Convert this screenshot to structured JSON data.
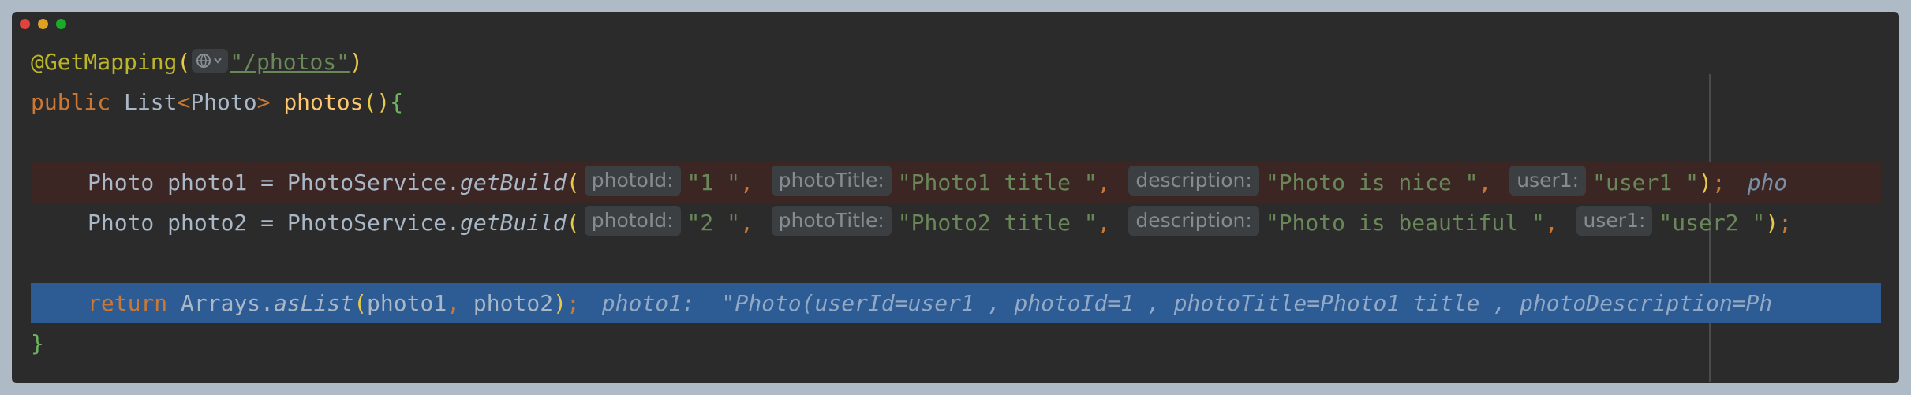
{
  "window": {
    "controls": [
      "close",
      "minimize",
      "zoom"
    ]
  },
  "code": {
    "line1": {
      "annotation": "@GetMapping",
      "open_paren": "(",
      "globe_icon": "globe-icon",
      "path": "\"/photos\"",
      "close_paren": ")"
    },
    "line2": {
      "kw": "public ",
      "type": "List",
      "lt": "<",
      "generic": "Photo",
      "gt": ">",
      "space": " ",
      "method": "photos",
      "parens": "()",
      "brace": "{"
    },
    "line3": {
      "decl": "Photo photo1 = PhotoService.",
      "method": "getBuild",
      "open_paren": "(",
      "hint1": "photoId:",
      "arg1": "\"1 \"",
      "comma1": ", ",
      "hint2": "photoTitle:",
      "arg2": "\"Photo1 title \"",
      "comma2": ", ",
      "hint3": "description:",
      "arg3": "\"Photo is nice \"",
      "comma3": ", ",
      "hint4": "user1:",
      "arg4": "\"user1 \"",
      "close_paren": ")",
      "semi": ";",
      "inline_value": "pho"
    },
    "line4": {
      "decl": "Photo photo2 = PhotoService.",
      "method": "getBuild",
      "open_paren": "(",
      "hint1": "photoId:",
      "arg1": "\"2 \"",
      "comma1": ", ",
      "hint2": "photoTitle:",
      "arg2": "\"Photo2 title \"",
      "comma2": ", ",
      "hint3": "description:",
      "arg3": "\"Photo is beautiful \"",
      "comma3": ", ",
      "hint4": "user1:",
      "arg4": "\"user2 \"",
      "close_paren": ")",
      "semi": ";"
    },
    "line5": {
      "kw": "return ",
      "class": "Arrays.",
      "method": "asList",
      "open_paren": "(",
      "args_a": "photo1",
      "comma": ", ",
      "args_b": "photo2",
      "close_paren": ")",
      "semi": ";",
      "inline_value": "photo1:  \"Photo(userId=user1 , photoId=1 , photoTitle=Photo1 title , photoDescription=Ph"
    },
    "line6": {
      "brace": "}"
    }
  },
  "colors": {
    "background": "#aebac6",
    "editor": "#2b2b2b",
    "keyword": "#cc7832",
    "string": "#6a8759",
    "function": "#ffc66d",
    "annotation": "#bbb529",
    "text": "#a9b7c6",
    "breakpoint_line": "#3b2624",
    "selection_line": "#2d5b94"
  }
}
